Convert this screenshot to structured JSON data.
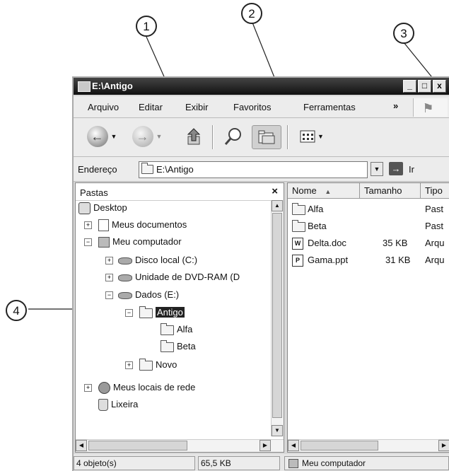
{
  "callouts": [
    "1",
    "2",
    "3",
    "4"
  ],
  "window": {
    "title": "E:\\Antigo",
    "buttons": {
      "minimize": "_",
      "maximize": "□",
      "close": "x"
    }
  },
  "menu": {
    "items": [
      "Arquivo",
      "Editar",
      "Exibir",
      "Favoritos",
      "Ferramentas"
    ],
    "more": "»"
  },
  "toolbar": {
    "back": "Voltar",
    "forward": "Avançar",
    "up": "Acima",
    "search": "Pesquisar",
    "folders": "Pastas",
    "views": "Modos de exibição"
  },
  "address": {
    "label": "Endereço",
    "value": "E:\\Antigo",
    "go": "Ir"
  },
  "folders_pane": {
    "title": "Pastas",
    "close": "×",
    "tree": [
      {
        "label": "Desktop"
      },
      {
        "label": "Meus documentos",
        "expander": "+"
      },
      {
        "label": "Meu computador",
        "expander": "−"
      },
      {
        "label": "Disco local (C:)",
        "expander": "+"
      },
      {
        "label": "Unidade de DVD-RAM (D",
        "expander": "+"
      },
      {
        "label": "Dados (E:)",
        "expander": "−"
      },
      {
        "label": "Antigo",
        "expander": "−"
      },
      {
        "label": "Alfa"
      },
      {
        "label": "Beta"
      },
      {
        "label": "Novo",
        "expander": "+"
      },
      {
        "label": "Meus locais de rede",
        "expander": "+"
      },
      {
        "label": "Lixeira"
      }
    ]
  },
  "files_pane": {
    "columns": [
      "Nome",
      "Tamanho",
      "Tipo"
    ],
    "sort_indicator": "▲",
    "rows": [
      {
        "name": "Alfa",
        "size": "",
        "type": "Past"
      },
      {
        "name": "Beta",
        "size": "",
        "type": "Past"
      },
      {
        "name": "Delta.doc",
        "size": "35 KB",
        "type": "Arqu"
      },
      {
        "name": "Gama.ppt",
        "size": "31 KB",
        "type": "Arqu"
      }
    ]
  },
  "status": {
    "objects": "4 objeto(s)",
    "size": "65,5 KB",
    "location": "Meu computador"
  }
}
